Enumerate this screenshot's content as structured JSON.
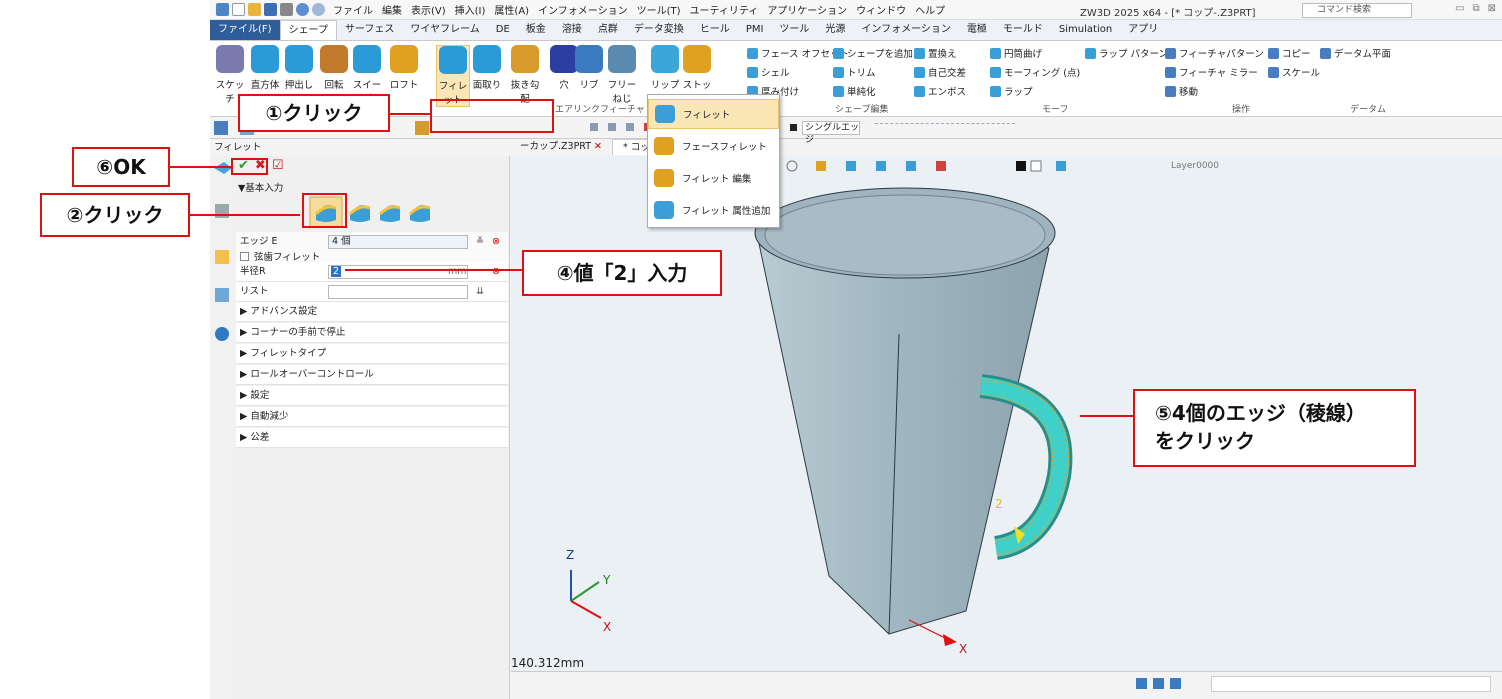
{
  "app": {
    "window_title": "ZW3D 2025 x64 - [* コップ-.Z3PRT]",
    "menu": [
      "ファイル",
      "編集",
      "表示(V)",
      "挿入(I)",
      "属性(A)",
      "インフォメーション",
      "ツール(T)",
      "ユーティリティ",
      "アプリケーション",
      "ウィンドウ",
      "ヘルプ"
    ],
    "ribbon_tabs": [
      "ファイル(F)",
      "シェープ",
      "サーフェス",
      "ワイヤフレーム",
      "DE",
      "板金",
      "溶接",
      "点群",
      "データ変換",
      "ヒール",
      "PMI",
      "ツール",
      "光源",
      "インフォメーション",
      "電極",
      "モールド",
      "Simulation",
      "アプリ"
    ],
    "command_search_placeholder": "コマンド検索"
  },
  "ribbon": {
    "big_buttons": [
      "スケッチ",
      "直方体",
      "押出し",
      "回転",
      "スイープ",
      "ロフト",
      "フィレット",
      "面取り",
      "抜き勾配",
      "穴",
      "リブ",
      "フリーねじ",
      "リップ",
      "ストック"
    ],
    "shape_edit_items": [
      "フェース オフセット",
      "シェープを追加",
      "置換え",
      "円筒曲げ",
      "ラップ パターン",
      "シェル",
      "トリム",
      "自己交差",
      "モーフィング (点)",
      "厚み付け",
      "単純化",
      "エンボス",
      "ラップ"
    ],
    "operation_items": [
      "フィーチャパターン",
      "コピー",
      "データム平面",
      "フィーチャ ミラー",
      "スケール",
      "移動"
    ],
    "group_labels": [
      "エアリンクフィーチャ",
      "シェープ編集",
      "モーフ",
      "操作",
      "データム"
    ]
  },
  "fillet_dropdown": {
    "items": [
      "フィレット",
      "フェースフィレット",
      "フィレット 編集",
      "フィレット 属性追加"
    ]
  },
  "toolbar2": {
    "filter_value": "シングルエッジ"
  },
  "manager_title": "フィレット",
  "doc_tabs": [
    {
      "label": "ーカップ.Z3PRT"
    },
    {
      "label": "* コップ-.Z3PRT"
    }
  ],
  "layer": "Layer0000",
  "panel": {
    "section_basic": "▼基本入力",
    "edge_label": "エッジ E",
    "edge_value": "4 個",
    "chord_fillet": "弦歯フィレット",
    "radius_label": "半径R",
    "radius_value": "2",
    "radius_unit": "mm",
    "list_label": "リスト",
    "sections": [
      "▶ アドバンス設定",
      "▶ コーナーの手前で停止",
      "▶ フィレットタイプ",
      "▶ ロールオーバーコントロール",
      "▶ 設定",
      "▶ 自動減少",
      "▶ 公差"
    ]
  },
  "viewport": {
    "dimension_label": "2",
    "axes": {
      "z": "Z",
      "y": "Y",
      "x": "X"
    },
    "x_marker": "X"
  },
  "status": {
    "distance": "140.312mm"
  },
  "callouts": {
    "c1": "①クリック",
    "c2": "②クリック",
    "c4": "④値「2」入力",
    "c5_line1": "⑤4個のエッジ（稜線）",
    "c5_line2": "をクリック",
    "c6": "⑥OK"
  },
  "colors": {
    "accent_red": "#e01010",
    "file_tab": "#2f5d9a",
    "cup": "#a7bcc6",
    "fillet_highlight": "#3fd0c9"
  }
}
